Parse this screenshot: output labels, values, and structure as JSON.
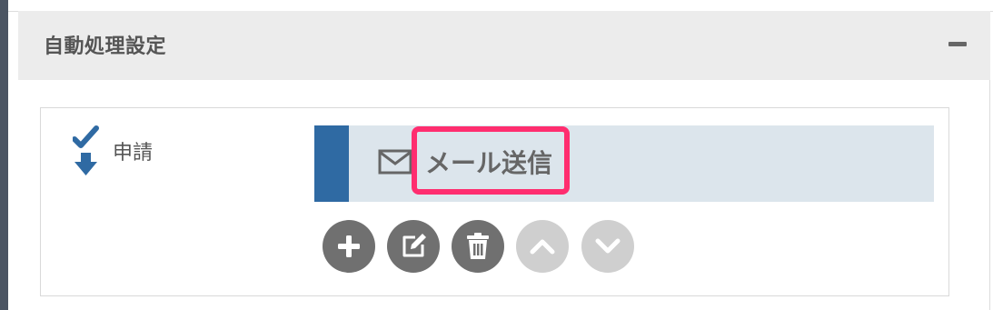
{
  "panel": {
    "title": "自動処理設定",
    "collapse_icon": "minus-icon"
  },
  "step": {
    "icon": "check-arrow-down-icon",
    "label": "申請"
  },
  "action": {
    "icon": "envelope-icon",
    "label": "メール送信",
    "accent_color": "#2f6aa3",
    "highlight_color": "#ff2d6f"
  },
  "buttons": [
    {
      "name": "add-button",
      "icon": "plus-icon",
      "enabled": true
    },
    {
      "name": "edit-button",
      "icon": "edit-icon",
      "enabled": true
    },
    {
      "name": "delete-button",
      "icon": "trash-icon",
      "enabled": true
    },
    {
      "name": "move-up-button",
      "icon": "chevron-up-icon",
      "enabled": false
    },
    {
      "name": "move-down-button",
      "icon": "chevron-down-icon",
      "enabled": false
    }
  ]
}
